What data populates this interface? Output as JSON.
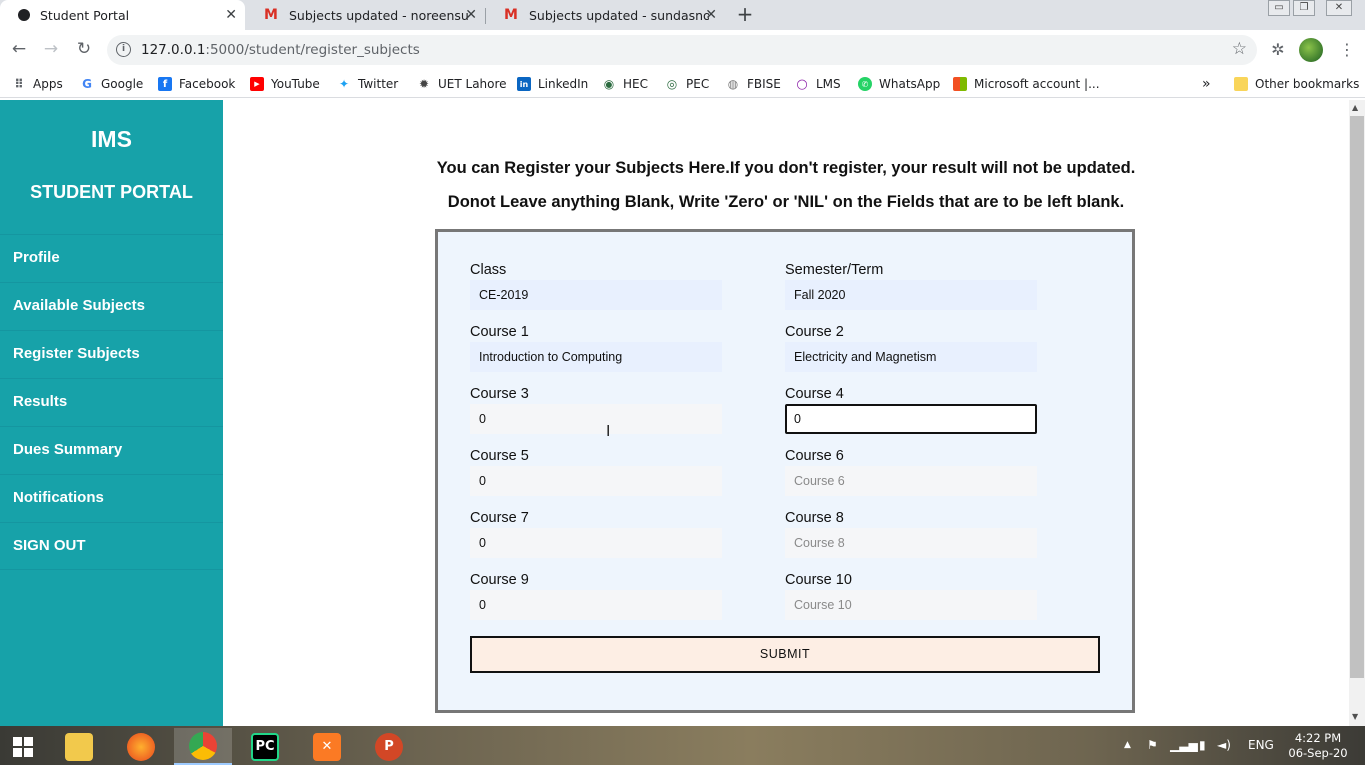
{
  "browser": {
    "tabs": [
      {
        "title": "Student Portal",
        "active": true
      },
      {
        "title": "Subjects updated - noreensunda",
        "active": false
      },
      {
        "title": "Subjects updated - sundasnoree",
        "active": false
      }
    ],
    "url_host": "127.0.0.1",
    "url_path": ":5000/student/register_subjects",
    "bookmarks": [
      {
        "label": "Apps",
        "icon": "apps-grid-icon"
      },
      {
        "label": "Google",
        "icon": "google-icon"
      },
      {
        "label": "Facebook",
        "icon": "facebook-icon"
      },
      {
        "label": "YouTube",
        "icon": "youtube-icon"
      },
      {
        "label": "Twitter",
        "icon": "twitter-icon"
      },
      {
        "label": "UET Lahore",
        "icon": "uet-icon"
      },
      {
        "label": "LinkedIn",
        "icon": "linkedin-icon"
      },
      {
        "label": "HEC",
        "icon": "hec-icon"
      },
      {
        "label": "PEC",
        "icon": "pec-icon"
      },
      {
        "label": "FBISE",
        "icon": "fbise-icon"
      },
      {
        "label": "LMS",
        "icon": "lms-icon"
      },
      {
        "label": "WhatsApp",
        "icon": "whatsapp-icon"
      },
      {
        "label": "Microsoft account |...",
        "icon": "microsoft-icon"
      }
    ],
    "overflow": "»",
    "other_bookmarks": "Other bookmarks"
  },
  "sidebar": {
    "brand": "IMS",
    "subtitle": "STUDENT PORTAL",
    "items": [
      {
        "label": "Profile"
      },
      {
        "label": "Available Subjects"
      },
      {
        "label": "Register Subjects"
      },
      {
        "label": "Results"
      },
      {
        "label": "Dues Summary"
      },
      {
        "label": "Notifications"
      },
      {
        "label": "SIGN OUT"
      }
    ]
  },
  "main": {
    "heading_line1": "You can Register your Subjects Here.If you don't register, your result will not be updated.",
    "heading_line2": "Donot Leave anything Blank, Write 'Zero' or 'NIL' on the Fields that are to be left blank.",
    "fields": [
      {
        "label": "Class",
        "value": "CE-2019",
        "placeholder": "Class"
      },
      {
        "label": "Semester/Term",
        "value": "Fall 2020",
        "placeholder": "Semester/Term"
      },
      {
        "label": "Course 1",
        "value": "Introduction to Computing",
        "placeholder": "Course 1"
      },
      {
        "label": "Course 2",
        "value": "Electricity and Magnetism",
        "placeholder": "Course 2"
      },
      {
        "label": "Course 3",
        "value": "0",
        "placeholder": "Course 3"
      },
      {
        "label": "Course 4",
        "value": "0",
        "placeholder": "Course 4"
      },
      {
        "label": "Course 5",
        "value": "0",
        "placeholder": "Course 5"
      },
      {
        "label": "Course 6",
        "value": "",
        "placeholder": "Course 6"
      },
      {
        "label": "Course 7",
        "value": "0",
        "placeholder": "Course 7"
      },
      {
        "label": "Course 8",
        "value": "",
        "placeholder": "Course 8"
      },
      {
        "label": "Course 9",
        "value": "0",
        "placeholder": "Course 9"
      },
      {
        "label": "Course 10",
        "value": "",
        "placeholder": "Course 10"
      }
    ],
    "submit_label": "SUBMIT"
  },
  "taskbar": {
    "language": "ENG",
    "time": "4:22 PM",
    "date": "06-Sep-20"
  },
  "colors": {
    "sidebar_bg": "#17a2a9",
    "form_bg": "#eef5fd",
    "submit_bg": "#fdeee4"
  }
}
